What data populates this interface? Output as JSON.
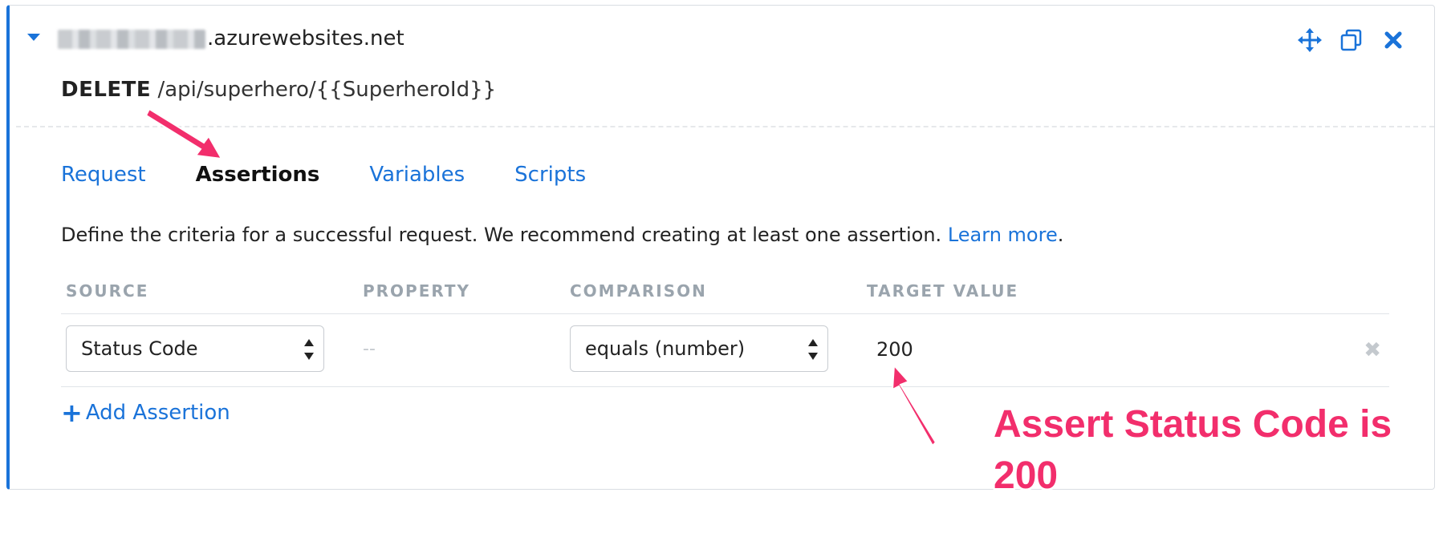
{
  "endpoint": {
    "host_visible": ".azurewebsites.net",
    "method": "DELETE",
    "path": "/api/superhero/{{SuperheroId}}"
  },
  "header_icons": [
    "move-icon",
    "duplicate-icon",
    "close-icon"
  ],
  "tabs": [
    {
      "label": "Request",
      "active": false
    },
    {
      "label": "Assertions",
      "active": true
    },
    {
      "label": "Variables",
      "active": false
    },
    {
      "label": "Scripts",
      "active": false
    }
  ],
  "description": {
    "text": "Define the criteria for a successful request. We recommend creating at least one assertion.",
    "link": "Learn more",
    "suffix": "."
  },
  "table": {
    "headers": [
      "SOURCE",
      "PROPERTY",
      "COMPARISON",
      "TARGET VALUE"
    ],
    "rows": [
      {
        "source": "Status Code",
        "property": "--",
        "comparison": "equals (number)",
        "target": "200"
      }
    ]
  },
  "add_assertion_label": "Add Assertion",
  "annotation": {
    "text": "Assert Status Code is 200",
    "color": "#f22e6c"
  },
  "colors": {
    "accent": "#1a73d9",
    "muted": "#9aa4ad"
  }
}
